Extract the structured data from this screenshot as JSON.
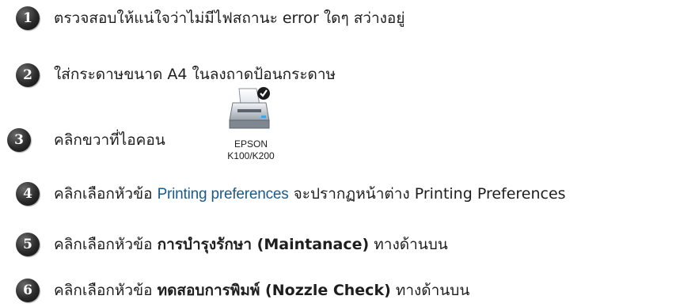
{
  "steps": [
    {
      "number": "1",
      "text": "ตรวจสอบให้แน่ใจว่าไม่มีไฟสถานะ error ใดๆ สว่างอยู่"
    },
    {
      "number": "2",
      "text": "ใส่กระดาษขนาด A4 ในลงถาดป้อนกระดาษ"
    },
    {
      "number": "3",
      "text": "คลิกขวาที่ไอคอน"
    },
    {
      "number": "4",
      "text_before": "คลิกเลือกหัวข้อ",
      "ui_label": "Printing preferences",
      "text_after": "จะปรากฏหน้าต่าง Printing Preferences"
    },
    {
      "number": "5",
      "text_before": "คลิกเลือกหัวข้อ",
      "bold": "การบำรุงรักษา (Maintanace)",
      "text_after": "ทางด้านบน"
    },
    {
      "number": "6",
      "text_before": "คลิกเลือกหัวข้อ",
      "bold": "ทดสอบการพิมพ์ (Nozzle Check)",
      "text_after": "ทางด้านบน"
    }
  ],
  "printer_icon": {
    "icon": "printer-default-icon",
    "label_line1": "EPSON",
    "label_line2": "K100/K200"
  }
}
